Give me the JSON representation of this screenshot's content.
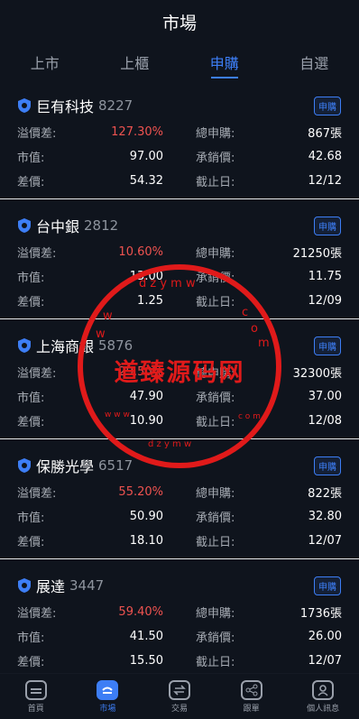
{
  "header": {
    "title": "市場"
  },
  "tabs": [
    {
      "label": "上市"
    },
    {
      "label": "上櫃"
    },
    {
      "label": "申購"
    },
    {
      "label": "自選"
    }
  ],
  "labels": {
    "premium": "溢價差:",
    "market": "市值:",
    "diff": "差價:",
    "total": "總申購:",
    "price": "承銷價:",
    "deadline": "截止日:"
  },
  "badge_label": "申購",
  "stocks": [
    {
      "name": "巨有科技",
      "code": "8227",
      "premium": "127.30%",
      "market": "97.00",
      "diff": "54.32",
      "total": "867張",
      "price": "42.68",
      "deadline": "12/12"
    },
    {
      "name": "台中銀",
      "code": "2812",
      "premium": "10.60%",
      "market": "13.00",
      "diff": "1.25",
      "total": "21250張",
      "price": "11.75",
      "deadline": "12/09"
    },
    {
      "name": "上海商銀",
      "code": "5876",
      "premium": "29.50%",
      "market": "47.90",
      "diff": "10.90",
      "total": "32300張",
      "price": "37.00",
      "deadline": "12/08"
    },
    {
      "name": "保勝光學",
      "code": "6517",
      "premium": "55.20%",
      "market": "50.90",
      "diff": "18.10",
      "total": "822張",
      "price": "32.80",
      "deadline": "12/07"
    },
    {
      "name": "展達",
      "code": "3447",
      "premium": "59.40%",
      "market": "41.50",
      "diff": "15.50",
      "total": "1736張",
      "price": "26.00",
      "deadline": "12/07"
    }
  ],
  "watermark": {
    "text": "道臻源码网"
  },
  "nav": [
    {
      "label": "首頁"
    },
    {
      "label": "市場"
    },
    {
      "label": "交易"
    },
    {
      "label": "跟單"
    },
    {
      "label": "個人訊息"
    }
  ],
  "colors": {
    "accent": "#3d7ef5",
    "red": "#ef5350",
    "background": "#0f141d",
    "watermark": "#e01a1a"
  }
}
